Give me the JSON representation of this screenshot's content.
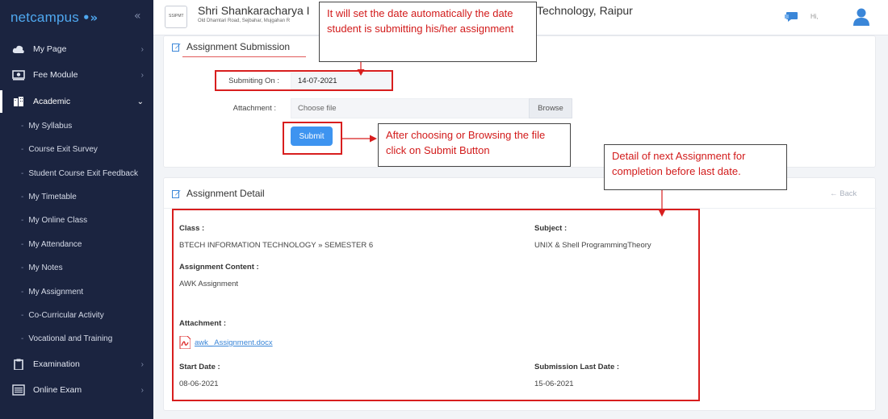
{
  "sidebar": {
    "brand": "netcampus",
    "brand_mark": "•»",
    "collapse_icon": "«",
    "items": [
      {
        "label": "My Page",
        "icon": "cloud-icon"
      },
      {
        "label": "Fee Module",
        "icon": "money-icon"
      },
      {
        "label": "Academic",
        "icon": "building-icon",
        "expanded": true
      },
      {
        "label": "Examination",
        "icon": "clipboard-icon"
      },
      {
        "label": "Online Exam",
        "icon": "list-icon"
      }
    ],
    "sub_items": [
      "My Syllabus",
      "Course Exit Survey",
      "Student Course Exit Feedback",
      "My Timetable",
      "My Online Class",
      "My Attendance",
      "My Notes",
      "My Assignment",
      "Co-Curricular Activity",
      "Vocational and Training"
    ]
  },
  "header": {
    "institute_name_left": "Shri Shankaracharya I",
    "institute_name_right": "Technology, Raipur",
    "address": "Old Dhamtari Road, Sejbahar, Mujgahan R",
    "logo_text": "SSIPMT",
    "greeting": "Hi,"
  },
  "submission": {
    "title": "Assignment Submission",
    "submitting_on_label": "Submiting On :",
    "submitting_on_value": "14-07-2021",
    "attachment_label": "Attachment :",
    "attachment_placeholder": "Choose file",
    "browse_label": "Browse",
    "submit_label": "Submit"
  },
  "detail": {
    "title": "Assignment Detail",
    "back_label": "← Back",
    "class_label": "Class :",
    "class_value": "BTECH INFORMATION TECHNOLOGY » SEMESTER 6",
    "subject_label": "Subject :",
    "subject_value": "UNIX & Shell ProgrammingTheory",
    "content_label": "Assignment Content :",
    "content_value": "AWK Assignment",
    "attachment_label": "Attachment :",
    "attachment_file": "awk_ Assignment.docx",
    "start_label": "Start Date :",
    "start_value": "08-06-2021",
    "last_label": "Submission Last Date :",
    "last_value": "15-06-2021"
  },
  "callouts": {
    "date_note": "It will set the date automatically the date student is submitting his/her assignment",
    "submit_note": "After choosing or Browsing the file click on Submit Button",
    "detail_note": "Detail of next Assignment for completion before last date."
  },
  "colors": {
    "sidebar_bg": "#1b2440",
    "accent": "#3e94f0",
    "annotation_red": "#d81e1e"
  }
}
